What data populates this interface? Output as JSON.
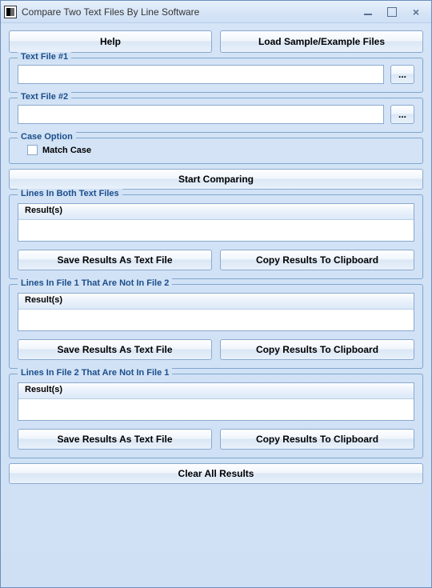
{
  "window": {
    "title": "Compare Two Text Files By Line Software"
  },
  "topButtons": {
    "help": "Help",
    "loadSample": "Load Sample/Example Files"
  },
  "file1": {
    "legend": "Text File #1",
    "value": "",
    "browse": "..."
  },
  "file2": {
    "legend": "Text File #2",
    "value": "",
    "browse": "..."
  },
  "caseOption": {
    "legend": "Case Option",
    "matchCase": "Match Case"
  },
  "startComparing": "Start Comparing",
  "resultsBoth": {
    "legend": "Lines In Both Text Files",
    "header": "Result(s)",
    "saveAsText": "Save Results As Text File",
    "copyClipboard": "Copy Results To Clipboard"
  },
  "results1not2": {
    "legend": "Lines In File 1 That Are Not In File 2",
    "header": "Result(s)",
    "saveAsText": "Save Results As Text File",
    "copyClipboard": "Copy Results To Clipboard"
  },
  "results2not1": {
    "legend": "Lines In File 2 That Are Not In File 1",
    "header": "Result(s)",
    "saveAsText": "Save Results As Text File",
    "copyClipboard": "Copy Results To Clipboard"
  },
  "clearAll": "Clear All Results"
}
